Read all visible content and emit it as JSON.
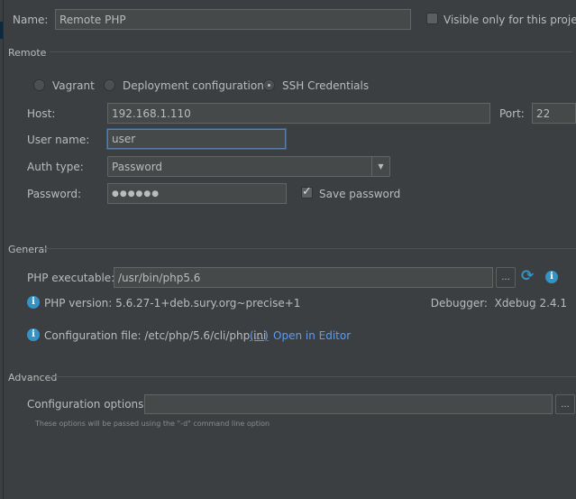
{
  "name": {
    "label": "Name:",
    "value": "Remote PHP"
  },
  "visible_only": {
    "label": "Visible only for this project",
    "checked": false
  },
  "remote": {
    "section": "Remote",
    "radios": [
      {
        "label": "Vagrant",
        "selected": false
      },
      {
        "label": "Deployment configuration",
        "selected": false
      },
      {
        "label": "SSH Credentials",
        "selected": true
      }
    ],
    "host": {
      "label": "Host:",
      "value": "192.168.1.110"
    },
    "port": {
      "label": "Port:",
      "value": "22"
    },
    "username": {
      "label": "User name:",
      "value": "user"
    },
    "auth_type": {
      "label": "Auth type:",
      "value": "Password"
    },
    "password": {
      "label": "Password:",
      "value": "●●●●●●"
    },
    "save_password": {
      "label": "Save password",
      "checked": true
    }
  },
  "general": {
    "section": "General",
    "php_exe": {
      "label": "PHP executable:",
      "value": "/usr/bin/php5.6",
      "browse": "..."
    },
    "php_version": "PHP version: 5.6.27-1+deb.sury.org~precise+1",
    "debugger": "Debugger:  Xdebug 2.4.1",
    "config_file": "Configuration file: /etc/php/5.6/cli/php.ini",
    "config_more": "(...)",
    "open_editor": "Open in Editor"
  },
  "advanced": {
    "section": "Advanced",
    "options": {
      "label": "Configuration options:",
      "value": "",
      "browse": "..."
    },
    "hint": "These options will be passed using the \"-d\" command line option"
  },
  "colors": {
    "accent": "#589df6",
    "background": "#3c3f41",
    "info": "#3592c4"
  }
}
